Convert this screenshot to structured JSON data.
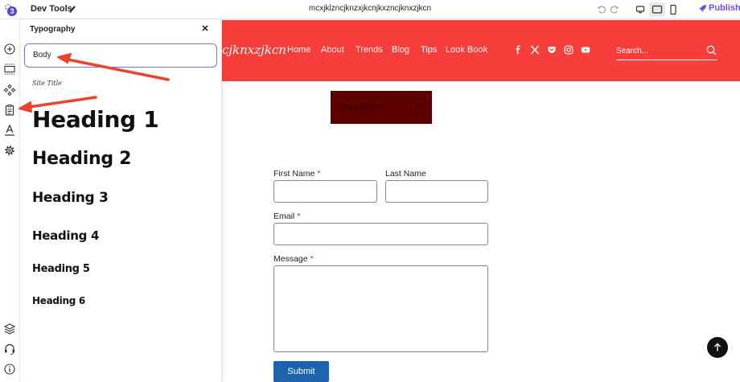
{
  "topbar": {
    "app_title": "Dev Tools",
    "doc_title": "mcxjklzncjknzxjkcnjkxzncjknxzjkcn",
    "publish_label": "Publish",
    "logo_char": "3"
  },
  "panel": {
    "title": "Typography",
    "close_glyph": "×",
    "body_label": "Body",
    "site_title_label": "Site Title",
    "headings": [
      "Heading 1",
      "Heading 2",
      "Heading 3",
      "Heading 4",
      "Heading 5",
      "Heading 6"
    ]
  },
  "site": {
    "brand": "cjknxzjkcn",
    "nav": [
      "Home",
      "About",
      "Trends",
      "Blog",
      "Tips",
      "Look Book"
    ],
    "search_placeholder": "Search...",
    "header_color": "#f73e3b",
    "dropdown_label": "Dropdo2wn"
  },
  "form": {
    "first_name_label": "First Name",
    "last_name_label": "Last Name",
    "email_label": "Email",
    "message_label": "Message",
    "required_mark": "*",
    "submit_label": "Submit"
  },
  "colors": {
    "accent": "#6c4cf1",
    "annotation_arrow": "#e8442e",
    "submit": "#1d63ad"
  }
}
